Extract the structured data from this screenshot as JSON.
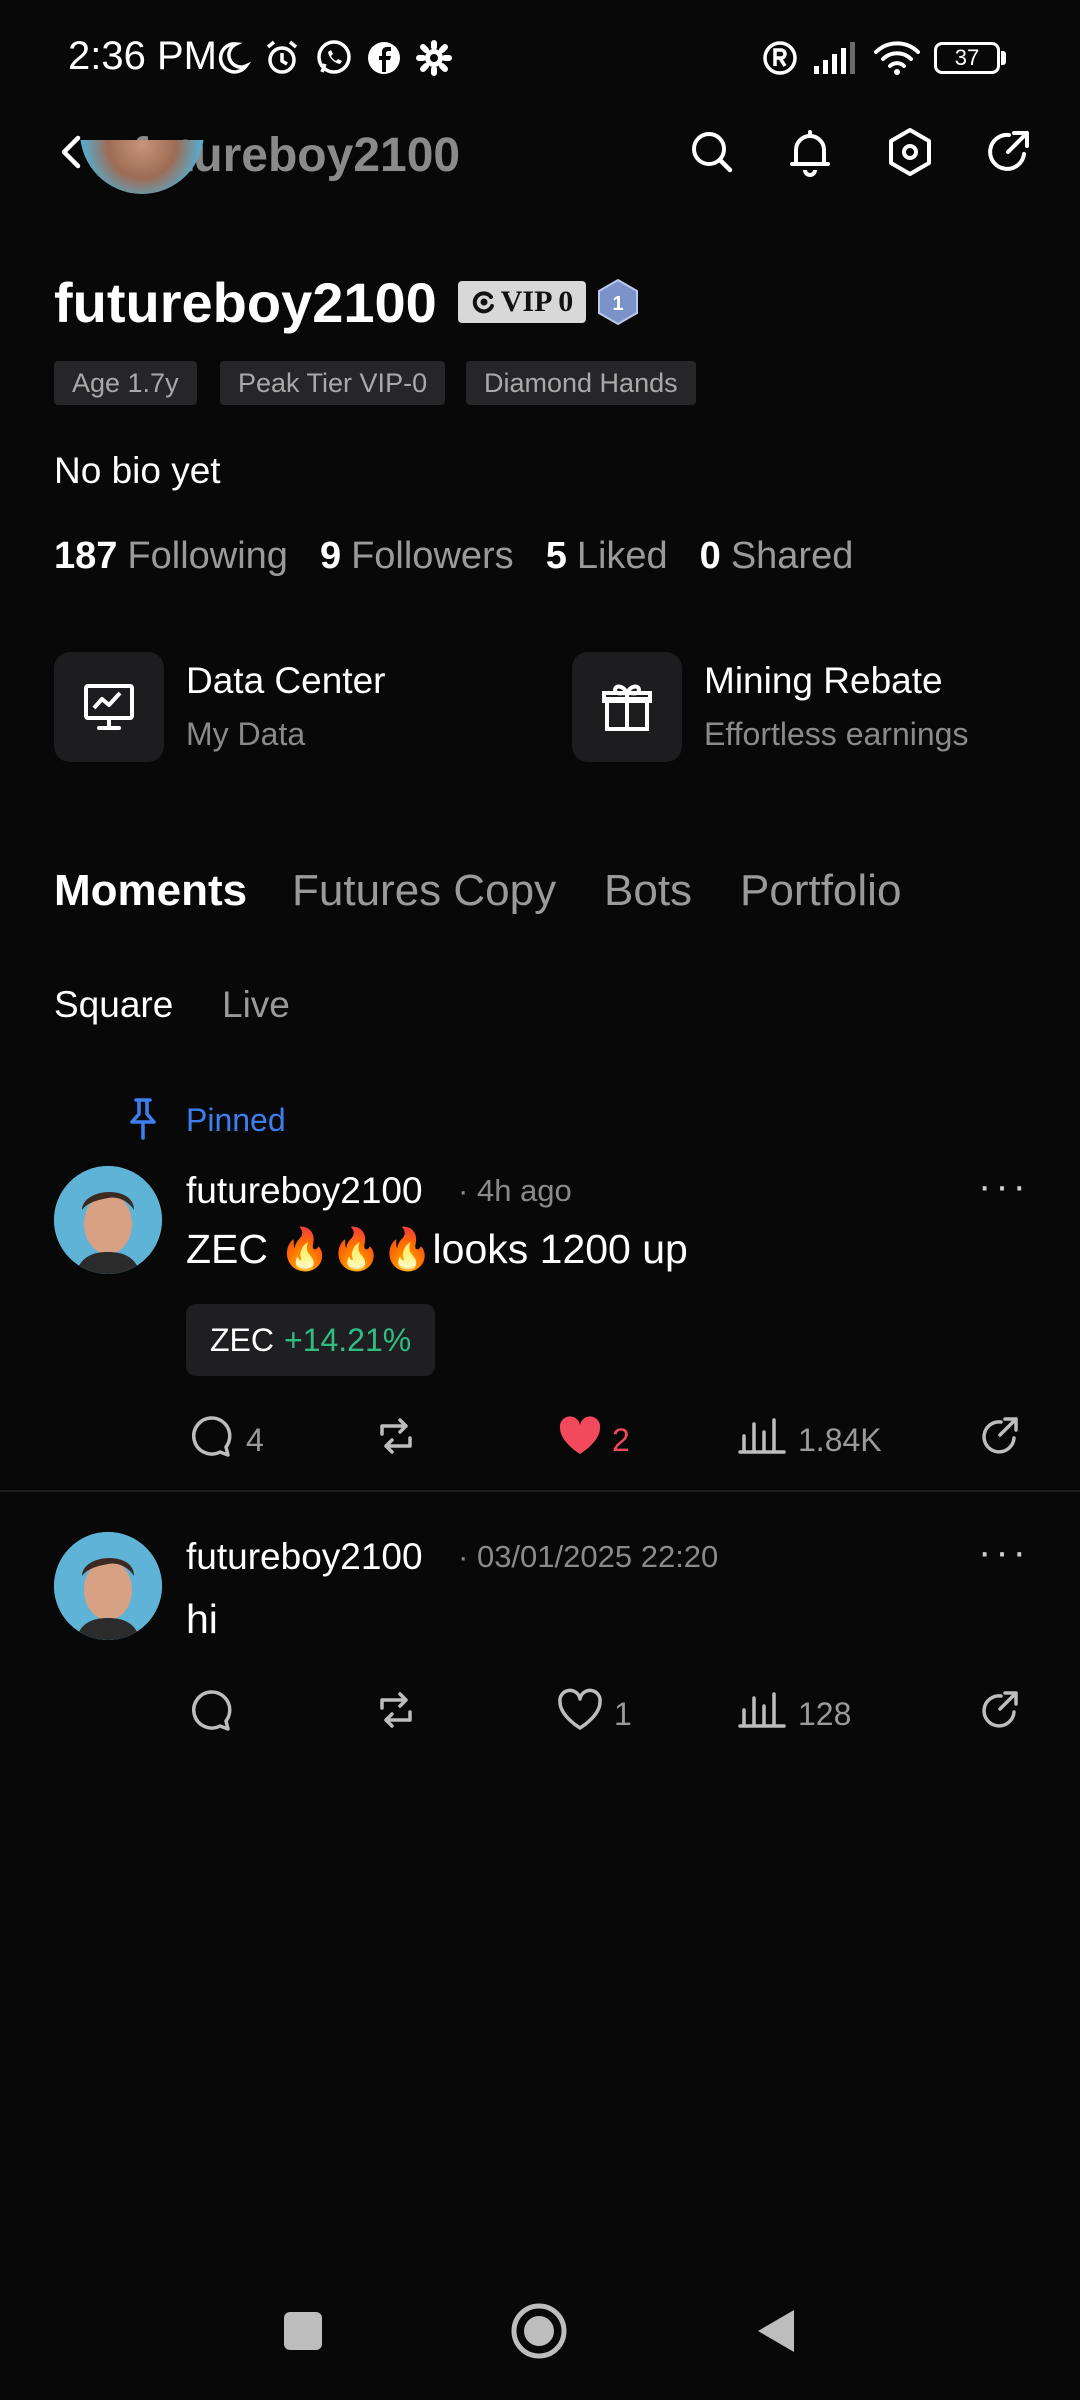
{
  "status_bar": {
    "time": "2:36 PM",
    "battery": "37",
    "icons": [
      "moon-icon",
      "alarm-icon",
      "whatsapp-icon",
      "facebook-icon",
      "settings-icon",
      "registered-icon",
      "signal-icon",
      "wifi-icon"
    ]
  },
  "header": {
    "title": "futureboy2100",
    "icons": [
      "back-icon",
      "search-icon",
      "bell-icon",
      "hexagon-settings-icon",
      "share-icon"
    ]
  },
  "profile": {
    "username": "futureboy2100",
    "vip_label": "VIP 0",
    "level": "1",
    "tags": [
      "Age 1.7y",
      "Peak Tier VIP-0",
      "Diamond Hands"
    ],
    "bio": "No bio yet",
    "stats": [
      {
        "value": "187",
        "label": "Following"
      },
      {
        "value": "9",
        "label": "Followers"
      },
      {
        "value": "5",
        "label": "Liked"
      },
      {
        "value": "0",
        "label": "Shared"
      }
    ]
  },
  "tiles": [
    {
      "title": "Data Center",
      "subtitle": "My Data",
      "icon": "chart-monitor-icon"
    },
    {
      "title": "Mining Rebate",
      "subtitle": "Effortless earnings",
      "icon": "gift-icon"
    }
  ],
  "tabs": [
    "Moments",
    "Futures Copy",
    "Bots",
    "Portfolio"
  ],
  "active_tab": "Moments",
  "subtabs": [
    "Square",
    "Live"
  ],
  "active_subtab": "Square",
  "posts": [
    {
      "pinned_label": "Pinned",
      "author": "futureboy2100",
      "time": "4h ago",
      "text": "ZEC 🔥🔥🔥looks 1200 up",
      "ticker": {
        "symbol": "ZEC",
        "change": "+14.21%"
      },
      "comments": "4",
      "likes": "2",
      "views": "1.84K",
      "liked": true
    },
    {
      "author": "futureboy2100",
      "time": "03/01/2025 22:20",
      "text": "hi",
      "comments": "",
      "likes": "1",
      "views": "128",
      "liked": false
    }
  ],
  "separator": "·",
  "more": "···",
  "colors": {
    "background": "#080808",
    "accent_blue": "#3d7ef0",
    "positive_green": "#2ebd85",
    "like_red": "#f2495d"
  }
}
